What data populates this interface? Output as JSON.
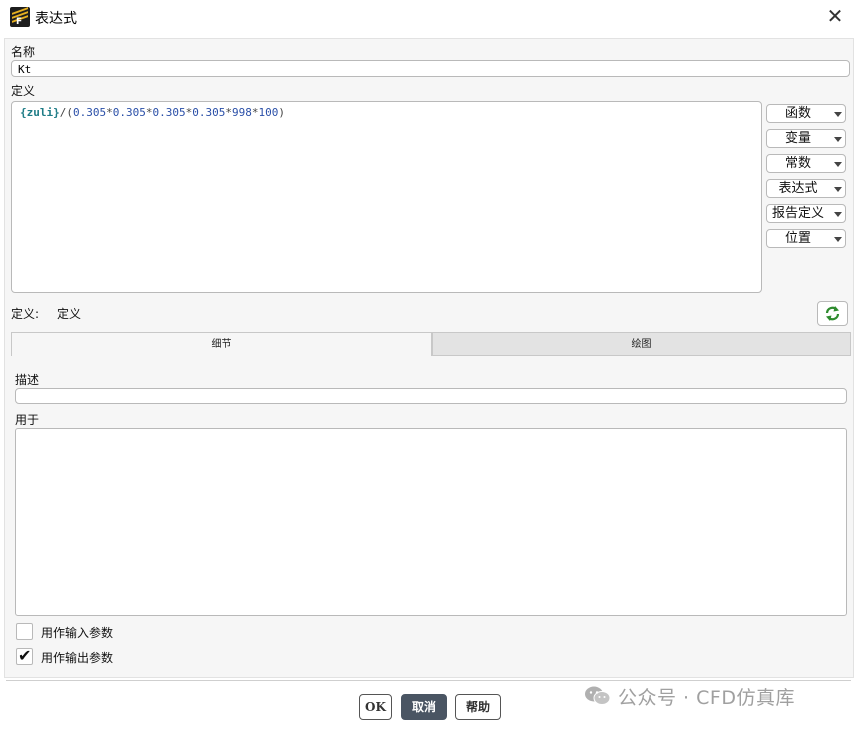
{
  "window": {
    "title": "表达式"
  },
  "name_section": {
    "label": "名称",
    "value": "Kt"
  },
  "definition_section": {
    "label": "定义",
    "expression_tokens": [
      {
        "text": "{zuli}",
        "kind": "var"
      },
      {
        "text": "/(",
        "kind": "op"
      },
      {
        "text": "0.305",
        "kind": "num"
      },
      {
        "text": "*",
        "kind": "op"
      },
      {
        "text": "0.305",
        "kind": "num"
      },
      {
        "text": "*",
        "kind": "op"
      },
      {
        "text": "0.305",
        "kind": "num"
      },
      {
        "text": "*",
        "kind": "op"
      },
      {
        "text": "0.305",
        "kind": "num"
      },
      {
        "text": "*",
        "kind": "op"
      },
      {
        "text": "998",
        "kind": "num"
      },
      {
        "text": "*",
        "kind": "op"
      },
      {
        "text": "100",
        "kind": "num"
      },
      {
        "text": ")",
        "kind": "op"
      }
    ],
    "side_buttons": [
      "函数",
      "变量",
      "常数",
      "表达式",
      "报告定义",
      "位置"
    ],
    "status_label": "定义:",
    "status_value": "定义"
  },
  "tabs": [
    {
      "label": "细节",
      "active": true
    },
    {
      "label": "绘图",
      "active": false
    }
  ],
  "details": {
    "description_label": "描述",
    "description_value": "",
    "used_in_label": "用于",
    "checkboxes": [
      {
        "label": "用作输入参数",
        "checked": false
      },
      {
        "label": "用作输出参数",
        "checked": true
      }
    ]
  },
  "footer": {
    "ok_label": "OK",
    "cancel_label": "取消",
    "help_label": "帮助"
  },
  "watermark": {
    "text": "公众号 · CFD仿真库"
  },
  "colors": {
    "variable_token": "#1e7c86",
    "number_token": "#2a4fa8",
    "primary_button": "#4a5563"
  }
}
